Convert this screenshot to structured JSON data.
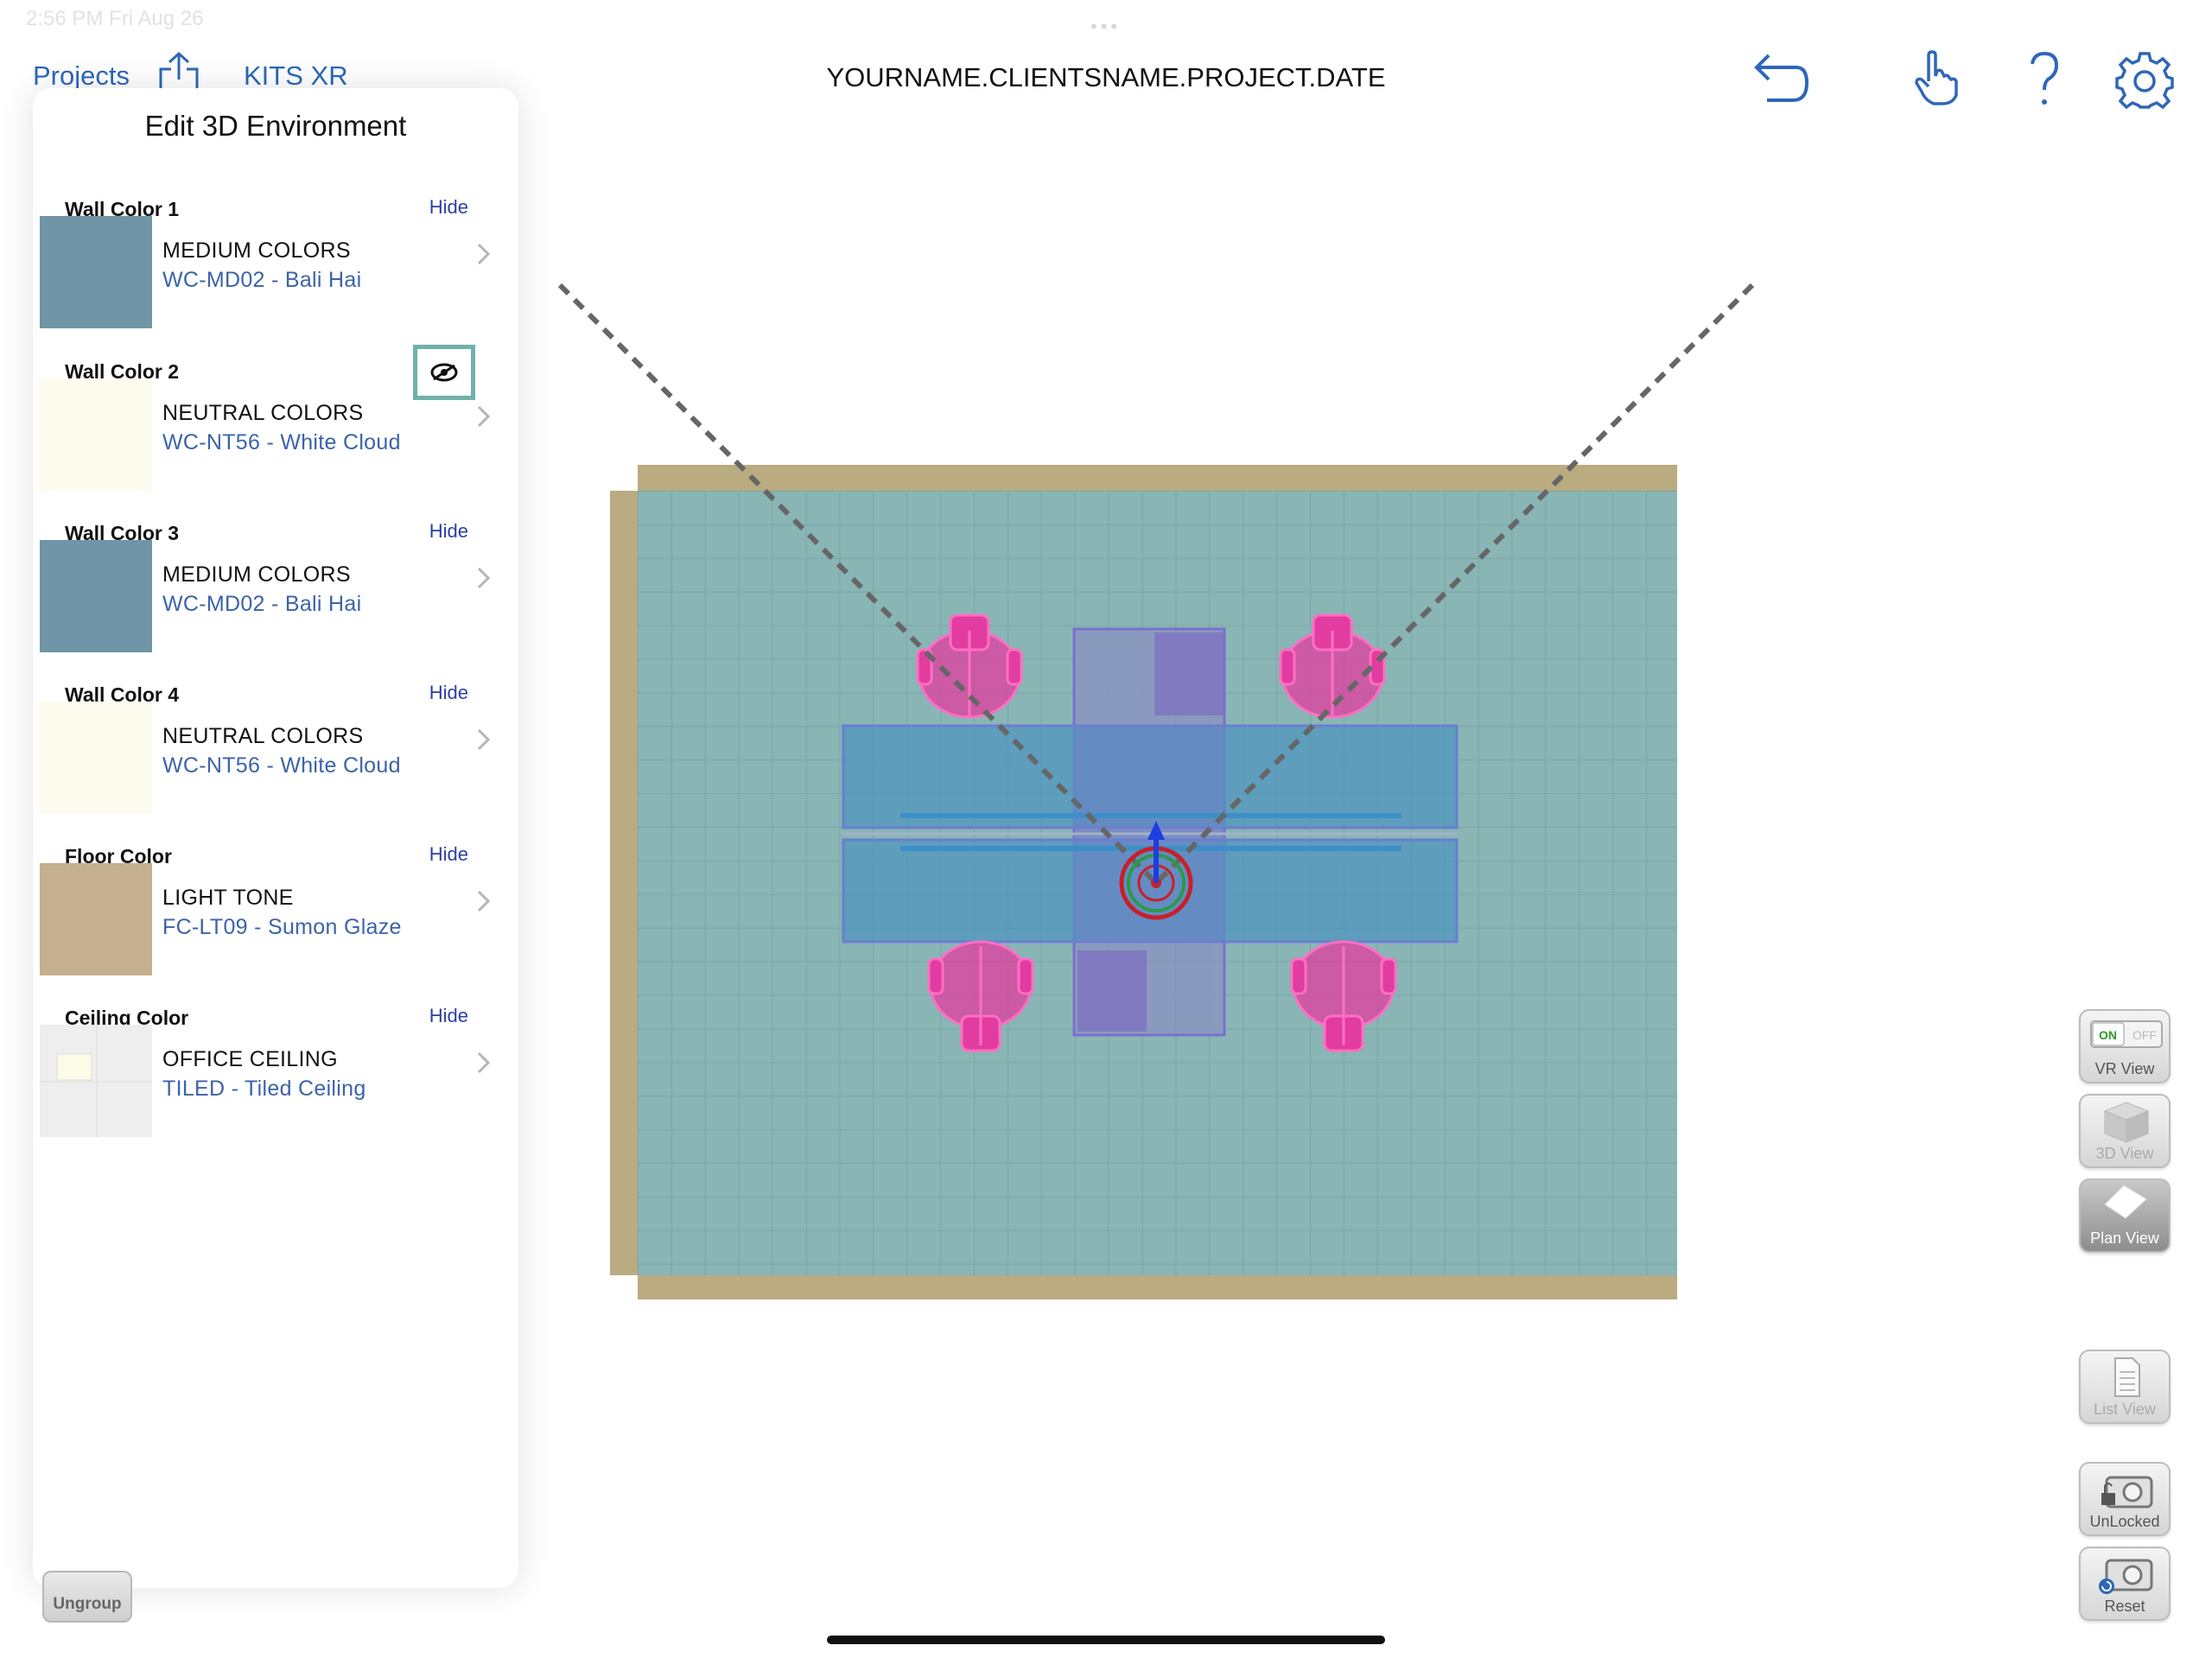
{
  "status_bar": {
    "time_date": "2:56 PM  Fri Aug 26"
  },
  "top_nav": {
    "projects_label": "Projects",
    "kits_label": "KITS XR",
    "project_title": "YOURNAME.CLIENTSNAME.PROJECT.DATE"
  },
  "toolbar_icons": [
    "share-icon",
    "undo-icon",
    "hand-pointer-icon",
    "help-icon",
    "gear-icon"
  ],
  "panel": {
    "title": "Edit 3D Environment",
    "sections": [
      {
        "label": "Wall Color 1",
        "action": "Hide",
        "category": "MEDIUM COLORS",
        "item": "WC-MD02 - Bali Hai",
        "swatch_color": "#6f95a6"
      },
      {
        "label": "Wall Color 2",
        "action_icon": "eye-hidden-icon",
        "category": "NEUTRAL COLORS",
        "item": "WC-NT56 - White Cloud",
        "swatch_color": "#fdfbee"
      },
      {
        "label": "Wall Color 3",
        "action": "Hide",
        "category": "MEDIUM COLORS",
        "item": "WC-MD02 - Bali Hai",
        "swatch_color": "#6f95a6"
      },
      {
        "label": "Wall Color 4",
        "action": "Hide",
        "category": "NEUTRAL COLORS",
        "item": "WC-NT56 - White Cloud",
        "swatch_color": "#fdfbee"
      },
      {
        "label": "Floor Color",
        "action": "Hide",
        "category": "LIGHT TONE",
        "item": "FC-LT09 - Sumon Glaze",
        "swatch_color": "#c4b08e"
      },
      {
        "label": "Ceiling Color",
        "action": "Hide",
        "category": "OFFICE CEILING",
        "item": "TILED - Tiled Ceiling",
        "swatch_color": "#ececec"
      }
    ]
  },
  "bottom_left": {
    "ungroup_label": "Ungroup"
  },
  "side_buttons": {
    "vr_view": {
      "label": "VR View",
      "on": "ON",
      "off": "OFF"
    },
    "view_3d": {
      "label": "3D View"
    },
    "plan_view": {
      "label": "Plan View"
    },
    "list_view": {
      "label": "List View"
    },
    "unlocked": {
      "label": "UnLocked"
    },
    "reset": {
      "label": "Reset"
    }
  },
  "colors": {
    "accent_blue": "#2e67b9",
    "room_floor": "#8ab5b5",
    "room_wall": "#baab80",
    "furniture": "#e23ca0"
  }
}
